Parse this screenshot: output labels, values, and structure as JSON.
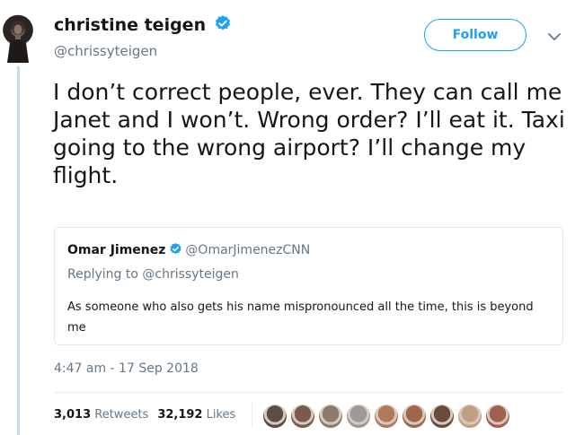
{
  "author": {
    "display_name": "christine teigen",
    "handle": "@chrissyteigen",
    "avatar": "avatar-christine"
  },
  "actions": {
    "follow_label": "Follow",
    "more_icon": "chevron-down-icon"
  },
  "tweet": {
    "text": "I don’t correct people, ever. They can call me Janet and I won’t. Wrong order? I’ll eat it. Taxi going to the wrong airport? I’ll change my flight.",
    "timestamp": "4:47 am - 17 Sep 2018"
  },
  "quoted_tweet": {
    "author_name": "Omar Jimenez",
    "author_handle": "@OmarJimenezCNN",
    "replying_to_prefix": "Replying to",
    "replying_to_handle": "@chrissyteigen",
    "text": "As someone who also gets his name mispronounced all the time, this is beyond me"
  },
  "stats": {
    "retweets_count": "3,013",
    "retweets_label": "Retweets",
    "likes_count": "32,192",
    "likes_label": "Likes"
  },
  "likers": [
    {
      "color": "#5a4d45"
    },
    {
      "color": "#7a5a4a"
    },
    {
      "color": "#8a7a70"
    },
    {
      "color": "#9a9a9a"
    },
    {
      "color": "#b07a5a"
    },
    {
      "color": "#a0684a"
    },
    {
      "color": "#6a4a3a"
    },
    {
      "color": "#c0a080"
    },
    {
      "color": "#a06050"
    }
  ],
  "colors": {
    "accent": "#1da1f2",
    "text": "#14171a",
    "muted": "#657786",
    "thread_line": "#c4dbf0"
  }
}
